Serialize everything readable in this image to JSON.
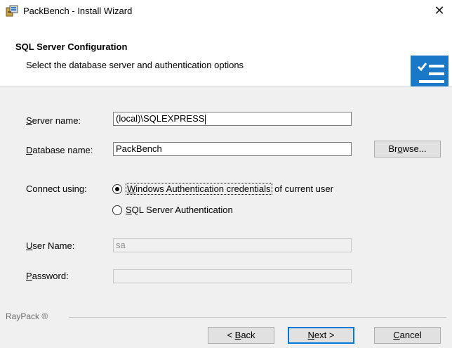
{
  "window": {
    "title": "PackBench - Install Wizard",
    "close_glyph": "✕"
  },
  "header": {
    "title": "SQL Server Configuration",
    "subtitle": "Select the database server and authentication options",
    "logo_icon": "checklist-icon"
  },
  "form": {
    "server_name": {
      "label_prefix": "",
      "label_accel": "S",
      "label_rest": "erver name:",
      "value": "(local)\\SQLEXPRESS"
    },
    "database_name": {
      "label_prefix": "",
      "label_accel": "D",
      "label_rest": "atabase name:",
      "value": "PackBench"
    },
    "browse_button": {
      "prefix": "Br",
      "accel": "o",
      "rest": "wse..."
    },
    "connect_using_label": "Connect using:",
    "auth_options": [
      {
        "accel": "W",
        "rest": "indows Authentication credentials",
        "suffix": "of current user",
        "selected": true
      },
      {
        "accel": "S",
        "rest": "QL Server Authentication",
        "suffix": "",
        "selected": false
      }
    ],
    "user_name": {
      "label_accel": "U",
      "label_rest": "ser Name:",
      "value": "sa"
    },
    "password": {
      "label_accel": "P",
      "label_rest": "assword:",
      "value": ""
    }
  },
  "footer": {
    "brand": "RayPack ®",
    "back_button": {
      "prefix": "< ",
      "accel": "B",
      "rest": "ack"
    },
    "next_button": {
      "prefix": "",
      "accel": "N",
      "rest": "ext >"
    },
    "cancel_button": {
      "prefix": "",
      "accel": "C",
      "rest": "ancel"
    }
  },
  "colors": {
    "accent": "#0078d7",
    "logo_blue": "#1a78c8"
  }
}
